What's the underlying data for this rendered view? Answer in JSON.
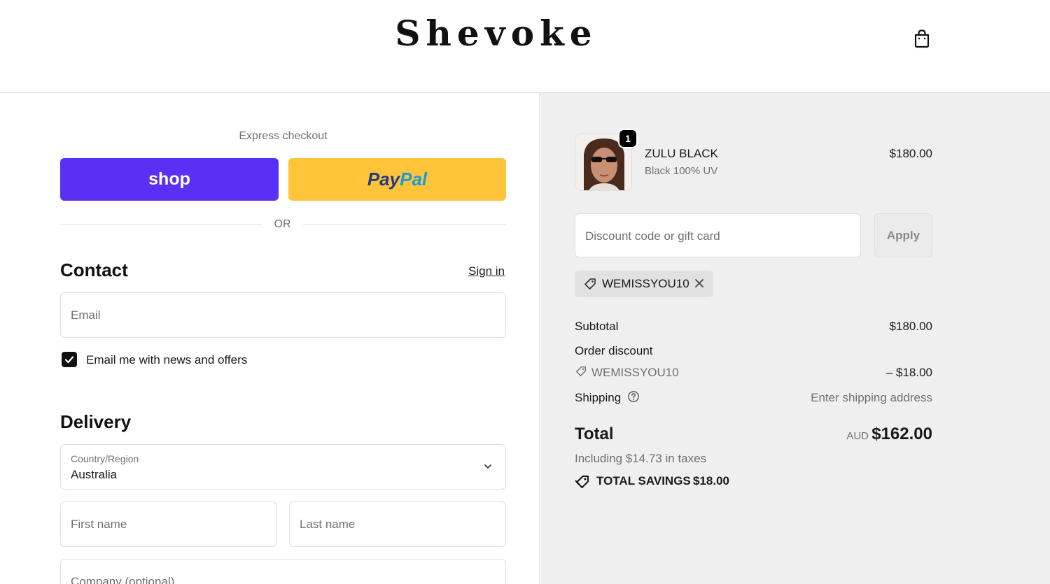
{
  "header": {
    "logo": "Shevoke",
    "cart_icon": "shopping-bag-icon"
  },
  "checkout": {
    "express_label": "Express checkout",
    "shop_pay_label": "shop",
    "paypal_label_part1": "Pay",
    "paypal_label_part2": "Pal",
    "or_label": "OR"
  },
  "contact": {
    "title": "Contact",
    "sign_in": "Sign in",
    "email_placeholder": "Email",
    "newsletter_checked": true,
    "newsletter_label": "Email me with news and offers"
  },
  "delivery": {
    "title": "Delivery",
    "country_label": "Country/Region",
    "country_value": "Australia",
    "first_name_placeholder": "First name",
    "last_name_placeholder": "Last name",
    "company_placeholder": "Company (optional)"
  },
  "summary": {
    "product": {
      "quantity": "1",
      "name": "ZULU BLACK",
      "variant": "Black 100% UV",
      "price": "$180.00"
    },
    "discount_placeholder": "Discount code or gift card",
    "apply_label": "Apply",
    "applied_code": "WEMISSYOU10",
    "subtotal_label": "Subtotal",
    "subtotal_value": "$180.00",
    "order_discount_label": "Order discount",
    "order_discount_code": "WEMISSYOU10",
    "order_discount_value": "– $18.00",
    "shipping_label": "Shipping",
    "shipping_value": "Enter shipping address",
    "total_label": "Total",
    "currency": "AUD",
    "total_value": "$162.00",
    "tax_note": "Including $14.73 in taxes",
    "savings_label": "TOTAL SAVINGS",
    "savings_value": "$18.00"
  },
  "colors": {
    "shop_pay": "#5a31f4",
    "paypal": "#ffc439",
    "summary_bg": "#efefef"
  }
}
